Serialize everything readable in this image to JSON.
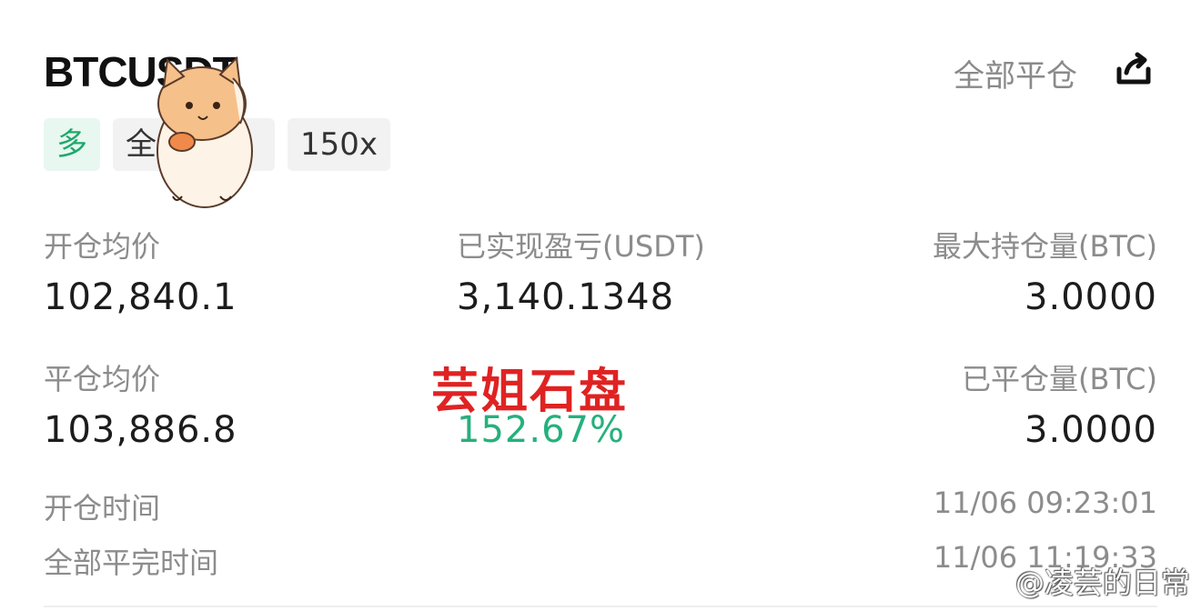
{
  "header": {
    "title": "BTCUSDT",
    "close_all_label": "全部平仓"
  },
  "tags": {
    "side": "多",
    "mode": "全仓",
    "leverage": "150x"
  },
  "stats": {
    "open_avg_price_label": "开仓均价",
    "open_avg_price_value": "102,840.1",
    "realized_pnl_label": "已实现盈亏(USDT)",
    "realized_pnl_value": "3,140.1348",
    "max_position_label": "最大持仓量(BTC)",
    "max_position_value": "3.0000",
    "close_avg_price_label": "平仓均价",
    "close_avg_price_value": "103,886.8",
    "roi_value": "152.67%",
    "closed_amount_label": "已平仓量(BTC)",
    "closed_amount_value": "3.0000"
  },
  "times": {
    "open_time_label": "开仓时间",
    "open_time_value": "11/06 09:23:01",
    "close_time_label": "全部平完时间",
    "close_time_value": "11/06 11:19:33"
  },
  "overlay": {
    "watermark": "芸姐石盘",
    "credit": "@凌芸的日常"
  },
  "colors": {
    "accent_green": "#26b07c",
    "watermark_red": "#e02222"
  },
  "icons": {
    "share": "share-icon",
    "sticker": "cat-sticker"
  }
}
